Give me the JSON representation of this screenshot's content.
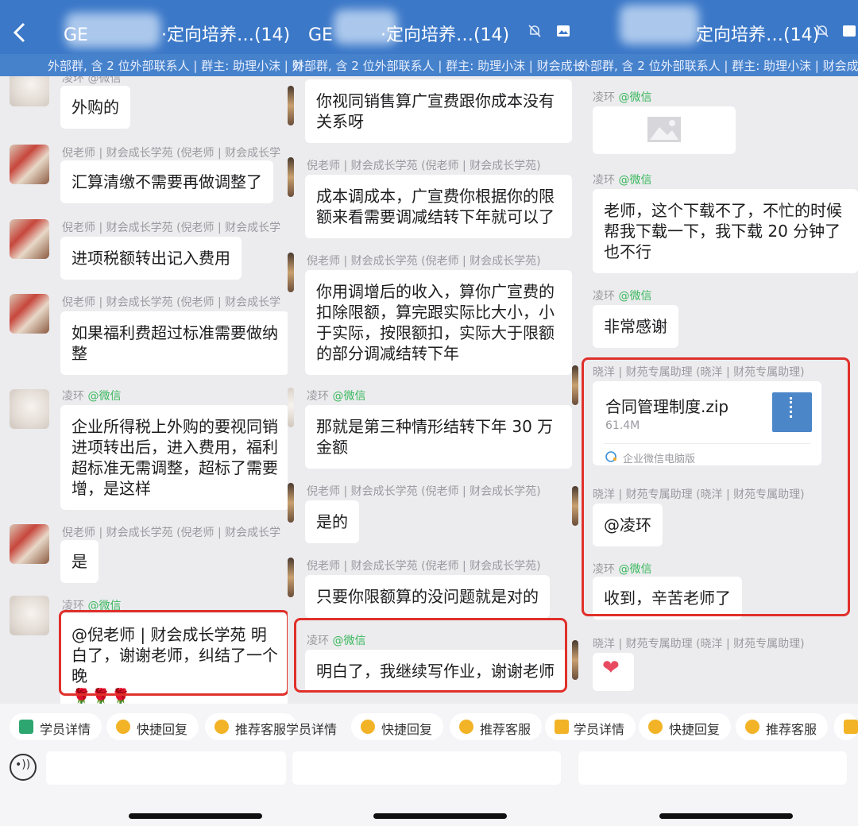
{
  "header": {
    "title_1": "GE",
    "title_1_tail": "·定向培养…(14)",
    "title_2": "GE",
    "title_2_tail": "·定向培养…(14)",
    "title_3_tail": "定向培养…(14)",
    "subtitle_1": "外部群, 含 2 位外部联系人 | 群主: 助理小沫 | 财",
    "subtitle_2": "外部群, 含 2 位外部联系人 | 群主: 助理小沫 | 财会成长",
    "subtitle_3": "外部群, 含 2 位外部联系人 | 群主: 助理小沫 | 财会成长"
  },
  "panel1": {
    "name_top": "凌环 @微信",
    "msg0": "外购的",
    "name1": "倪老师 | 财会成长学苑 (倪老师 | 财会成长学",
    "msg1": "汇算清缴不需要再做调整了",
    "name2": "倪老师 | 财会成长学苑 (倪老师 | 财会成长学",
    "msg2": "进项税额转出记入费用",
    "name3": "倪老师 | 财会成长学苑 (倪老师 | 财会成长学",
    "msg3": "如果福利费超过标准需要做纳整",
    "name4_a": "凌环",
    "name4_b": "@微信",
    "msg4": "企业所得税上外购的要视同销进项转出后，进入费用，福利超标准无需调整，超标了需要增，是这样",
    "name5": "倪老师 | 财会成长学苑 (倪老师 | 财会成长学",
    "msg5": "是",
    "name6_a": "凌环",
    "name6_b": "@微信",
    "msg6": "@倪老师 | 财会成长学苑 明白了，谢谢老师，纠结了一个晚",
    "msg6_emoji": "🌹🌹🌹"
  },
  "panel2": {
    "msg0": "你视同销售算广宣费跟你成本没有关系呀",
    "name1": "倪老师 | 财会成长学苑 (倪老师 | 财会成长学苑)",
    "msg1": "成本调成本，广宣费你根据你的限额来看需要调减结转下年就可以了",
    "name2": "倪老师 | 财会成长学苑 (倪老师 | 财会成长学苑)",
    "msg2": "你用调增后的收入，算你广宣费的扣除限额，算完跟实际比大小，小于实际，按限额扣，实际大于限额的部分调减结转下年",
    "name3_a": "凌环",
    "name3_b": "@微信",
    "msg3": "那就是第三种情形结转下年 30 万金额",
    "name4": "倪老师 | 财会成长学苑 (倪老师 | 财会成长学苑)",
    "msg4": "是的",
    "name5": "倪老师 | 财会成长学苑 (倪老师 | 财会成长学苑)",
    "msg5": "只要你限额算的没问题就是对的",
    "name6_a": "凌环",
    "name6_b": "@微信",
    "msg6": "明白了，我继续写作业，谢谢老师"
  },
  "panel3": {
    "name1_a": "凌环",
    "name1_b": "@微信",
    "name2_a": "凌环",
    "name2_b": "@微信",
    "msg2": "老师，这个下载不了，不忙的时候帮我下载一下，我下载 20 分钟了也不行",
    "name3_a": "凌环",
    "name3_b": "@微信",
    "msg3": "非常感谢",
    "name4": "晓洋 | 财苑专属助理 (晓洋 | 财苑专属助理)",
    "file_name": "合同管理制度.zip",
    "file_size": "61.4M",
    "file_source": "企业微信电脑版",
    "name5": "晓洋 | 财苑专属助理 (晓洋 | 财苑专属助理)",
    "msg5": "@凌环",
    "name6_a": "凌环",
    "name6_b": "@微信",
    "msg6": "收到，辛苦老师了",
    "name7": "晓洋 | 财苑专属助理 (晓洋 | 财苑专属助理)",
    "msg7": "❤"
  },
  "bottom": {
    "chip_student": "学员详情",
    "chip_quick": "快捷回复",
    "chip_recommend": "推荐客服"
  },
  "colors": {
    "header_blue": "#3b78c8",
    "wx_green": "#39b75b",
    "highlight_red": "#e0302b"
  }
}
